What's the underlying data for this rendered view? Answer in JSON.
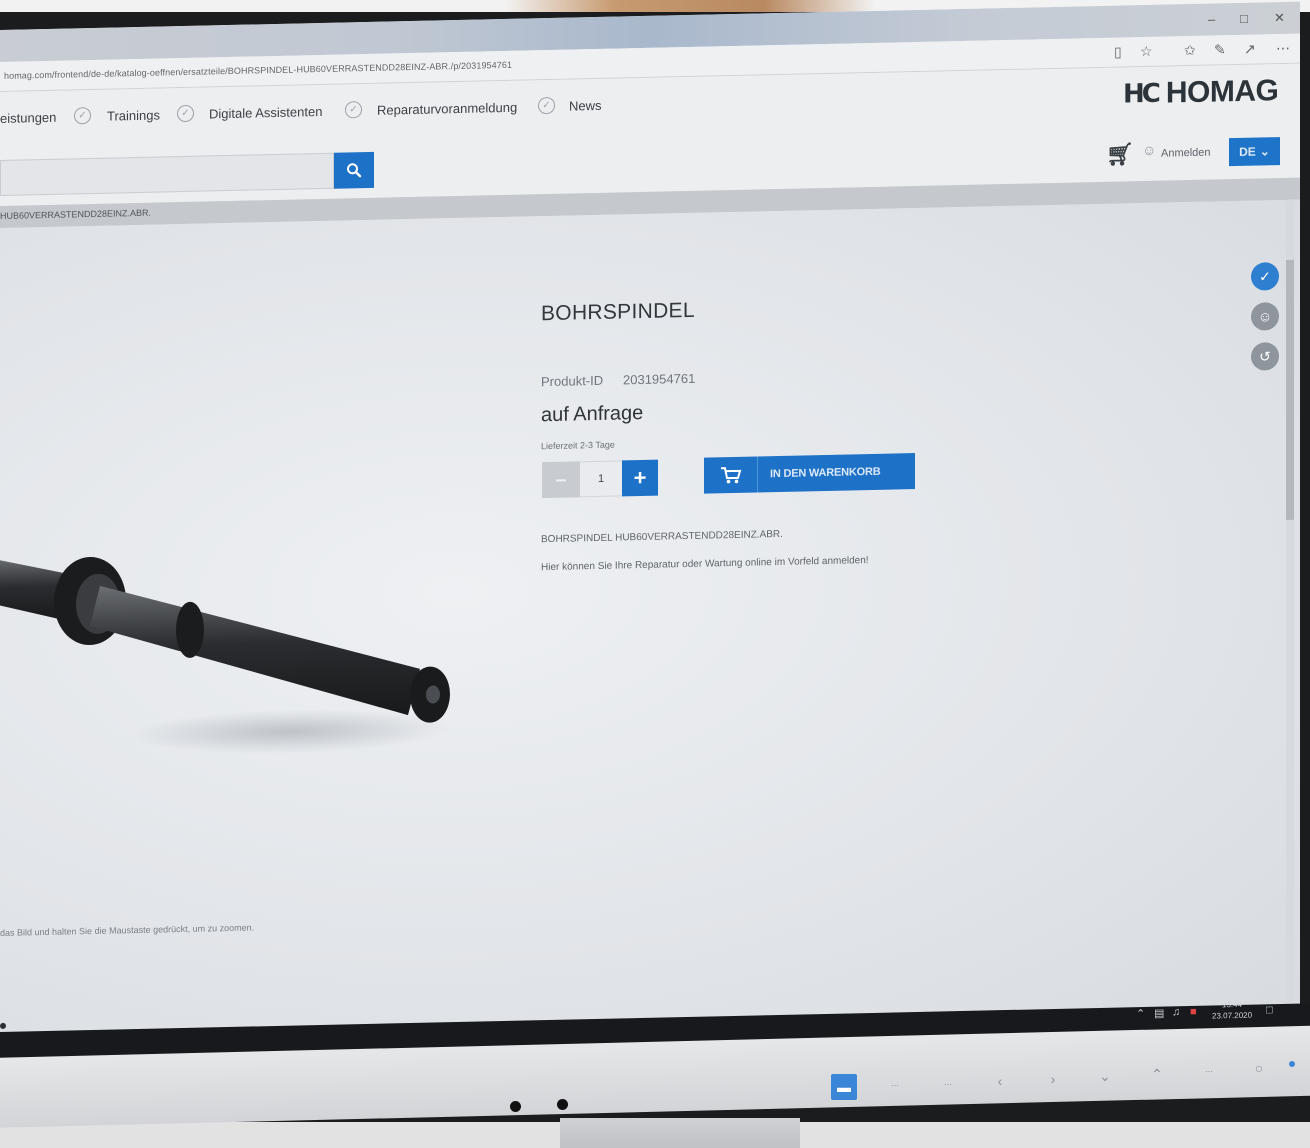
{
  "browser": {
    "url": "homag.com/frontend/de-de/katalog-oeffnen/ersatzteile/BOHRSPINDEL-HUB60VERRASTENDD28EINZ-ABR./p/2031954761",
    "controls": {
      "minimize": "–",
      "maximize": "□",
      "close": "✕"
    },
    "toolbar_icons": [
      "reading-view-icon",
      "favorite-star-icon",
      "favorites-bar-icon",
      "pen-icon",
      "share-icon",
      "more-icon"
    ]
  },
  "nav": {
    "items": [
      "eistungen",
      "Trainings",
      "Digitale Assistenten",
      "Reparaturvoranmeldung",
      "News"
    ]
  },
  "logo": {
    "mark": "HC",
    "text": "HOMAG"
  },
  "header": {
    "search_placeholder": "",
    "login_label": "Anmelden",
    "language": "DE"
  },
  "breadcrumb": "HUB60VERRASTENDD28EINZ.ABR.",
  "product": {
    "title": "BOHRSPINDEL",
    "id_label": "Produkt-ID",
    "id_value": "2031954761",
    "price": "auf Anfrage",
    "delivery": "Lieferzeit 2-3 Tage",
    "quantity": "1",
    "minus": "–",
    "plus": "+",
    "add_to_cart": "IN DEN WARENKORB",
    "description": "BOHRSPINDEL HUB60VERRASTENDD28EINZ.ABR.",
    "repair_info": "Hier können Sie Ihre Reparatur oder Wartung online im Vorfeld anmelden!"
  },
  "image_hint": "das Bild und halten Sie die Maustaste gedrückt, um zu zoomen.",
  "taskbar": {
    "apps": [
      "cortana-icon",
      "task-view-icon",
      "edge-icon",
      "explorer-icon",
      "word-icon",
      "excel-icon",
      "outlook-icon",
      "visio-icon",
      "acrobat-icon"
    ],
    "time": "13:44",
    "date": "23.07.2020"
  },
  "colors": {
    "accent": "#1d72c8",
    "brand_text": "#2d3439"
  }
}
